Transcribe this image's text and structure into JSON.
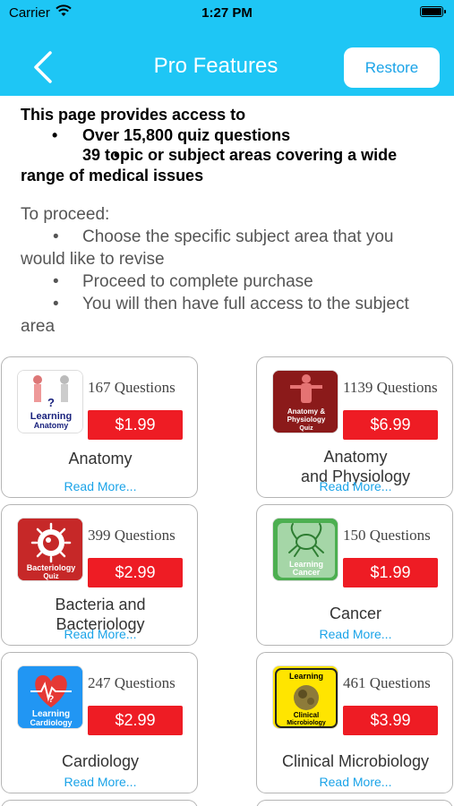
{
  "status_bar": {
    "carrier": "Carrier",
    "time": "1:27 PM"
  },
  "nav": {
    "title": "Pro Features",
    "restore_label": "Restore"
  },
  "intro": {
    "heading": "This page provides access to",
    "bullets": [
      "Over 15,800 quiz questions",
      "39 topic or subject areas covering a wide range of medical issues"
    ],
    "proceed_heading": "To proceed:",
    "steps": [
      "Choose the specific subject area that you would like to revise",
      "Proceed to complete purchase",
      "You will then have full access to the subject area"
    ]
  },
  "cards": [
    {
      "questions": "167 Questions",
      "price": "$1.99",
      "name": "Anatomy",
      "more": "Read More...",
      "icon": "learning-anatomy-icon",
      "icon_text": "Learning Anatomy",
      "color": "#ffffff"
    },
    {
      "questions": "1139 Questions",
      "price": "$6.99",
      "name_line1": "Anatomy",
      "name_line2": "and Physiology",
      "more": "Read More...",
      "icon": "anatomy-physiology-quiz-icon",
      "icon_text": "Anatomy & Physiology Quiz",
      "color": "#8b1a1a"
    },
    {
      "questions": "399 Questions",
      "price": "$2.99",
      "name_line1": "Bacteria and",
      "name_line2": "Bacteriology",
      "more": "Read More...",
      "icon": "bacteriology-quiz-icon",
      "icon_text": "Bacteriology Quiz",
      "color": "#c62828"
    },
    {
      "questions": "150 Questions",
      "price": "$1.99",
      "name": "Cancer",
      "more": "Read More...",
      "icon": "learning-cancer-icon",
      "icon_text": "Learning Cancer",
      "color": "#4caf50"
    },
    {
      "questions": "247 Questions",
      "price": "$2.99",
      "name": "Cardiology",
      "more": "Read More...",
      "icon": "learning-cardiology-icon",
      "icon_text": "Learning Cardiology",
      "color": "#2196f3"
    },
    {
      "questions": "461 Questions",
      "price": "$3.99",
      "name": "Clinical Microbiology",
      "more": "Read More...",
      "icon": "clinical-microbiology-icon",
      "icon_text": "Learning Clinical Microbiology",
      "color": "#ffe500"
    }
  ],
  "colors": {
    "nav_bg": "#1ec6f5",
    "price_bg": "#ee1c24",
    "link": "#1aa3e8"
  }
}
